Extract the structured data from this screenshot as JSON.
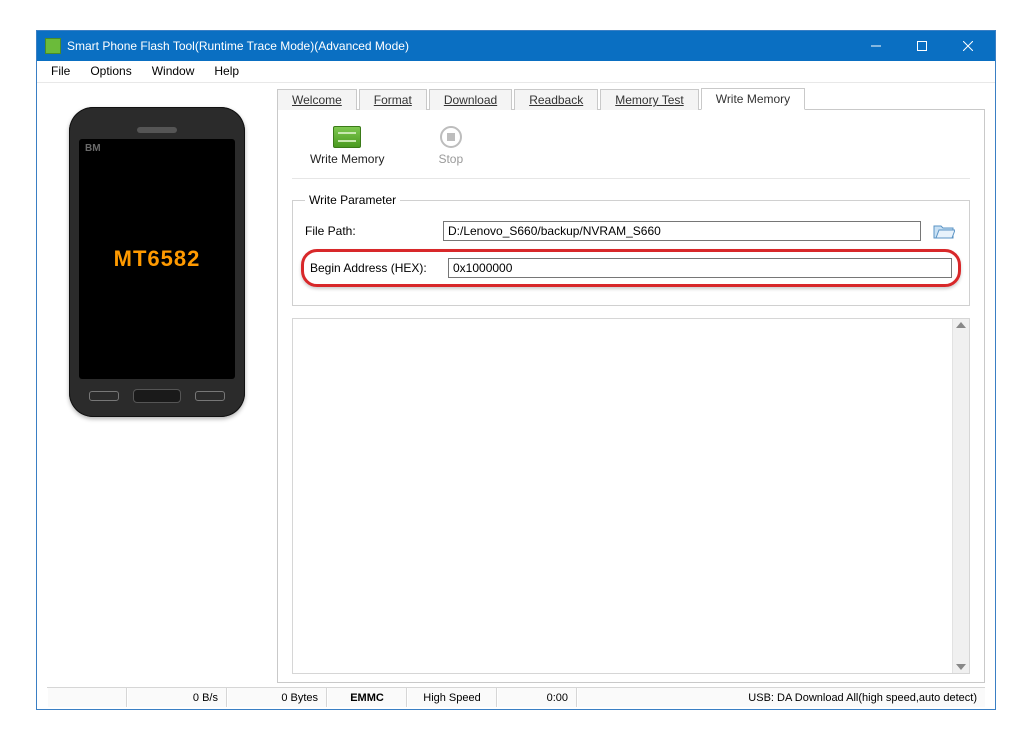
{
  "window": {
    "title": "Smart Phone Flash Tool(Runtime Trace Mode)(Advanced Mode)"
  },
  "menu": {
    "file": "File",
    "options": "Options",
    "window": "Window",
    "help": "Help"
  },
  "phone": {
    "bm": "BM",
    "chip": "MT6582"
  },
  "tabs": {
    "welcome": "Welcome",
    "format": "Format",
    "download": "Download",
    "readback": "Readback",
    "memory_test": "Memory Test",
    "write_memory": "Write Memory"
  },
  "toolbar": {
    "write_memory": "Write Memory",
    "stop": "Stop"
  },
  "write_param": {
    "legend": "Write Parameter",
    "file_path_label": "File Path:",
    "file_path_value": "D:/Lenovo_S660/backup/NVRAM_S660",
    "begin_addr_label": "Begin Address (HEX):",
    "begin_addr_value": "0x1000000"
  },
  "status": {
    "rate": "0 B/s",
    "bytes": "0 Bytes",
    "storage": "EMMC",
    "speed": "High Speed",
    "time": "0:00",
    "usb": "USB: DA Download All(high speed,auto detect)"
  }
}
